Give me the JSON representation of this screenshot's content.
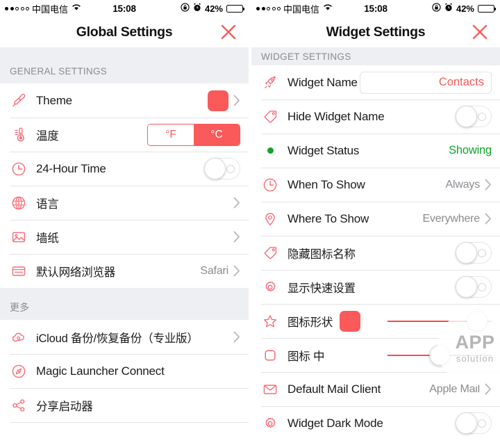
{
  "status_bar": {
    "carrier": "中国电信",
    "signal_dots_filled": 2,
    "signal_dots_total": 5,
    "wifi_icon": "wifi-icon",
    "time": "15:08",
    "rotation_lock_icon": "rotation-lock-icon",
    "alarm_icon": "alarm-clock-icon",
    "battery_percent": "42%",
    "battery_level": 42
  },
  "colors": {
    "accent_red": "#fa5a5a",
    "icon_red": "#fa6a75",
    "status_green": "#10a42c",
    "section_bg": "#eeeff2",
    "value_gray": "#8a8a90"
  },
  "left_screen": {
    "nav": {
      "title": "Global Settings",
      "close_icon": "close-icon"
    },
    "sections": [
      {
        "header": "GENERAL SETTINGS",
        "rows": [
          {
            "icon": "paintbrush-icon",
            "label": "Theme",
            "control": "color-swatch",
            "swatch_color": "#fa5a5a",
            "chevron": true
          },
          {
            "icon": "thermometer-icon",
            "label": "温度",
            "control": "segmented",
            "options": [
              "°F",
              "°C"
            ],
            "selected": "°C",
            "chevron": false
          },
          {
            "icon": "clock-icon",
            "label": "24-Hour Time",
            "control": "toggle",
            "toggle_on": false,
            "chevron": false
          },
          {
            "icon": "globe-icon",
            "label": "语言",
            "control": "none",
            "chevron": true
          },
          {
            "icon": "wallpaper-icon",
            "label": "墙纸",
            "control": "none",
            "chevron": true
          },
          {
            "icon": "browser-icon",
            "label": "默认网络浏览器",
            "control": "value",
            "value": "Safari",
            "chevron": true
          }
        ]
      },
      {
        "header": "更多",
        "rows": [
          {
            "icon": "icloud-icon",
            "label": "iCloud 备份/恢复备份（专业版）",
            "control": "none",
            "chevron": true
          },
          {
            "icon": "magic-launcher-icon",
            "label": "Magic Launcher Connect",
            "control": "none",
            "chevron": false
          },
          {
            "icon": "share-icon",
            "label": "分享启动器",
            "control": "none",
            "chevron": false
          }
        ]
      }
    ]
  },
  "right_screen": {
    "nav": {
      "title": "Widget Settings",
      "close_icon": "close-icon"
    },
    "sections": [
      {
        "header": "WIDGET SETTINGS",
        "rows": [
          {
            "icon": "rocket-icon",
            "label": "Widget Name",
            "control": "textfield",
            "value": "Contacts",
            "chevron": false
          },
          {
            "icon": "tag-icon",
            "label": "Hide Widget Name",
            "control": "toggle",
            "toggle_on": false,
            "chevron": false
          },
          {
            "icon": "status-dot-icon",
            "label": "Widget Status",
            "control": "value-green",
            "value": "Showing",
            "chevron": false
          },
          {
            "icon": "clock-icon",
            "label": "When To Show",
            "control": "value",
            "value": "Always",
            "chevron": true
          },
          {
            "icon": "pin-icon",
            "label": "Where To Show",
            "control": "value",
            "value": "Everywhere",
            "chevron": true
          },
          {
            "icon": "tag-icon",
            "label": "隐藏图标名称",
            "control": "toggle",
            "toggle_on": false,
            "chevron": false
          },
          {
            "icon": "gear-icon",
            "label": "显示快速设置",
            "control": "toggle",
            "toggle_on": false,
            "chevron": false
          },
          {
            "icon": "star-icon",
            "label": "图标形状",
            "control": "swatch-slider",
            "swatch_color": "#fa5a5a",
            "slider_percent": 86,
            "chevron": false
          },
          {
            "icon": "rounded-square-icon",
            "label": "图标 中",
            "control": "slider",
            "slider_percent": 50,
            "chevron": false
          },
          {
            "icon": "mail-icon",
            "label": "Default Mail Client",
            "control": "value",
            "value": "Apple Mail",
            "chevron": true
          },
          {
            "icon": "gear-icon",
            "label": "Widget Dark Mode",
            "control": "toggle",
            "toggle_on": false,
            "chevron": false
          }
        ]
      }
    ]
  },
  "watermark": {
    "top": "APP",
    "bottom": "solution"
  }
}
